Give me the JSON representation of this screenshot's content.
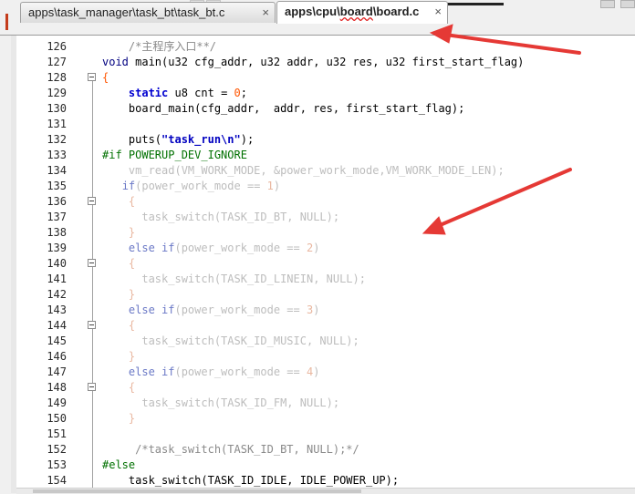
{
  "tabs": [
    {
      "label": "apps\\task_manager\\task_bt\\task_bt.c",
      "close": "×",
      "active": false
    },
    {
      "label_prefix": "apps\\cpu\\",
      "label_underlined": "board",
      "label_suffix": "\\board.c",
      "close": "×",
      "active": true
    }
  ],
  "editor": {
    "lines": [
      {
        "n": "126",
        "tokens": [
          {
            "t": "    ",
            "c": ""
          },
          {
            "t": "/*主程序入口**/",
            "c": "t-comment"
          }
        ]
      },
      {
        "n": "127",
        "tokens": [
          {
            "t": "void",
            "c": "t-type"
          },
          {
            "t": " main(u32 cfg_addr, u32 addr, u32 res, u32 first_start_flag)",
            "c": ""
          }
        ]
      },
      {
        "n": "128",
        "fold": true,
        "tokens": [
          {
            "t": "{",
            "c": "t-num"
          }
        ]
      },
      {
        "n": "129",
        "tokens": [
          {
            "t": "    ",
            "c": ""
          },
          {
            "t": "static",
            "c": "t-kw"
          },
          {
            "t": " u8 cnt = ",
            "c": ""
          },
          {
            "t": "0",
            "c": "t-num"
          },
          {
            "t": ";",
            "c": ""
          }
        ]
      },
      {
        "n": "130",
        "tokens": [
          {
            "t": "    board_main(cfg_addr,  addr, res, first_start_flag);",
            "c": ""
          }
        ]
      },
      {
        "n": "131",
        "tokens": []
      },
      {
        "n": "132",
        "tokens": [
          {
            "t": "    puts(",
            "c": ""
          },
          {
            "t": "\"task_run\\n\"",
            "c": "t-str"
          },
          {
            "t": ");",
            "c": ""
          }
        ]
      },
      {
        "n": "133",
        "tokens": [
          {
            "t": "#if POWERUP_DEV_IGNORE",
            "c": "t-pre"
          }
        ]
      },
      {
        "n": "134",
        "tokens": [
          {
            "t": "    vm_read(VM_WORK_MODE, &power_work_mode,VM_WORK_MODE_LEN);",
            "c": "t-grey"
          }
        ]
      },
      {
        "n": "135",
        "tokens": [
          {
            "t": "   ",
            "c": ""
          },
          {
            "t": "if",
            "c": "t-greykw"
          },
          {
            "t": "(power_work_mode == ",
            "c": "t-grey"
          },
          {
            "t": "1",
            "c": "t-greynum"
          },
          {
            "t": ")",
            "c": "t-grey"
          }
        ]
      },
      {
        "n": "136",
        "fold": true,
        "tokens": [
          {
            "t": "    {",
            "c": "t-greynum"
          }
        ]
      },
      {
        "n": "137",
        "tokens": [
          {
            "t": "      task_switch(TASK_ID_BT, NULL);",
            "c": "t-grey"
          }
        ]
      },
      {
        "n": "138",
        "tokens": [
          {
            "t": "    }",
            "c": "t-greynum"
          }
        ]
      },
      {
        "n": "139",
        "tokens": [
          {
            "t": "    ",
            "c": ""
          },
          {
            "t": "else if",
            "c": "t-greykw"
          },
          {
            "t": "(power_work_mode == ",
            "c": "t-grey"
          },
          {
            "t": "2",
            "c": "t-greynum"
          },
          {
            "t": ")",
            "c": "t-grey"
          }
        ]
      },
      {
        "n": "140",
        "fold": true,
        "tokens": [
          {
            "t": "    {",
            "c": "t-greynum"
          }
        ]
      },
      {
        "n": "141",
        "tokens": [
          {
            "t": "      task_switch(TASK_ID_LINEIN, NULL);",
            "c": "t-grey"
          }
        ]
      },
      {
        "n": "142",
        "tokens": [
          {
            "t": "    }",
            "c": "t-greynum"
          }
        ]
      },
      {
        "n": "143",
        "tokens": [
          {
            "t": "    ",
            "c": ""
          },
          {
            "t": "else if",
            "c": "t-greykw"
          },
          {
            "t": "(power_work_mode == ",
            "c": "t-grey"
          },
          {
            "t": "3",
            "c": "t-greynum"
          },
          {
            "t": ")",
            "c": "t-grey"
          }
        ]
      },
      {
        "n": "144",
        "fold": true,
        "tokens": [
          {
            "t": "    {",
            "c": "t-greynum"
          }
        ]
      },
      {
        "n": "145",
        "tokens": [
          {
            "t": "      task_switch(TASK_ID_MUSIC, NULL);",
            "c": "t-grey"
          }
        ]
      },
      {
        "n": "146",
        "tokens": [
          {
            "t": "    }",
            "c": "t-greynum"
          }
        ]
      },
      {
        "n": "147",
        "tokens": [
          {
            "t": "    ",
            "c": ""
          },
          {
            "t": "else if",
            "c": "t-greykw"
          },
          {
            "t": "(power_work_mode == ",
            "c": "t-grey"
          },
          {
            "t": "4",
            "c": "t-greynum"
          },
          {
            "t": ")",
            "c": "t-grey"
          }
        ]
      },
      {
        "n": "148",
        "fold": true,
        "tokens": [
          {
            "t": "    {",
            "c": "t-greynum"
          }
        ]
      },
      {
        "n": "149",
        "tokens": [
          {
            "t": "      task_switch(TASK_ID_FM, NULL);",
            "c": "t-grey"
          }
        ]
      },
      {
        "n": "150",
        "tokens": [
          {
            "t": "    }",
            "c": "t-greynum"
          }
        ]
      },
      {
        "n": "151",
        "tokens": []
      },
      {
        "n": "152",
        "tokens": [
          {
            "t": "     /*task_switch(TASK_ID_BT, NULL);*/",
            "c": "t-comment"
          }
        ]
      },
      {
        "n": "153",
        "tokens": [
          {
            "t": "#else",
            "c": "t-pre"
          }
        ]
      },
      {
        "n": "154",
        "tokens": [
          {
            "t": "    task_switch(TASK_ID_IDLE, IDLE_POWER_UP);",
            "c": ""
          }
        ]
      }
    ]
  },
  "colors": {
    "annotation_arrow": "#e53935",
    "keyword": "#0000d0",
    "preprocessor": "#007000",
    "comment": "#8a8a8a",
    "inactive_code": "#bdbdbd"
  },
  "icons": {
    "tab_close": "close-icon",
    "fold_marker": "fold-minus-icon",
    "annotation": "red-arrow-annotation"
  }
}
